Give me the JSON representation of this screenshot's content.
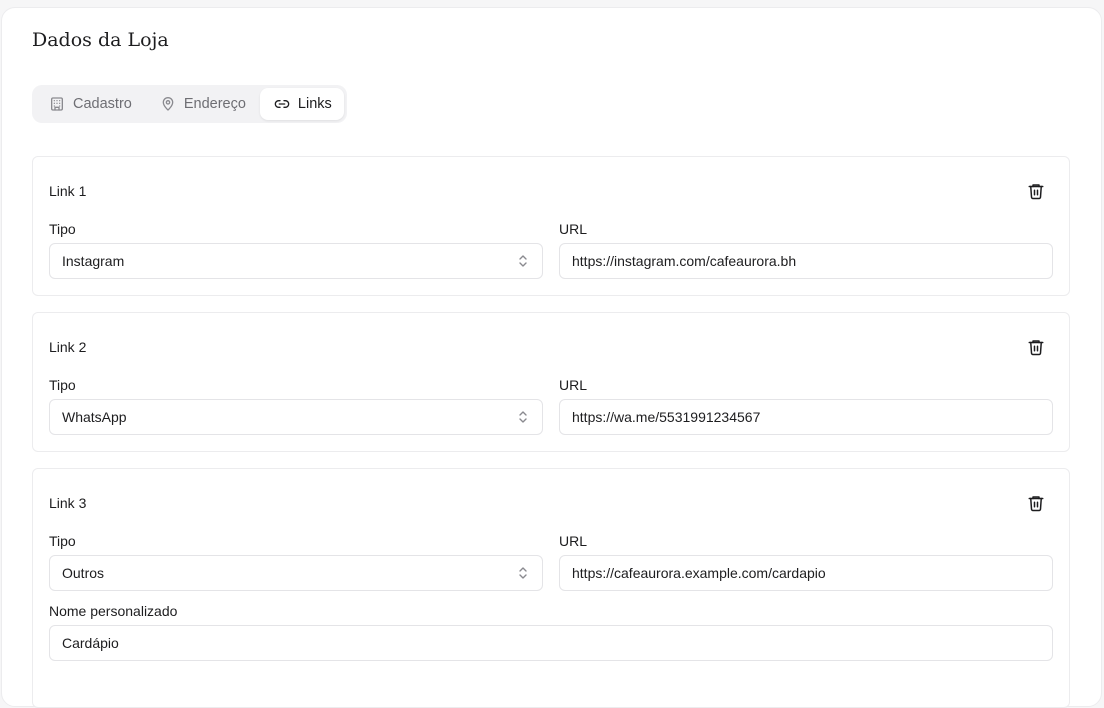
{
  "page": {
    "title": "Dados da Loja"
  },
  "tabs": [
    {
      "label": "Cadastro",
      "icon": "building-icon",
      "active": false
    },
    {
      "label": "Endereço",
      "icon": "map-pin-icon",
      "active": false
    },
    {
      "label": "Links",
      "icon": "link-icon",
      "active": true
    }
  ],
  "links": [
    {
      "title": "Link 1",
      "tipo_label": "Tipo",
      "tipo_value": "Instagram",
      "url_label": "URL",
      "url_value": "https://instagram.com/cafeaurora.bh"
    },
    {
      "title": "Link 2",
      "tipo_label": "Tipo",
      "tipo_value": "WhatsApp",
      "url_label": "URL",
      "url_value": "https://wa.me/5531991234567"
    },
    {
      "title": "Link 3",
      "tipo_label": "Tipo",
      "tipo_value": "Outros",
      "url_label": "URL",
      "url_value": "https://cafeaurora.example.com/cardapio",
      "custom_label": "Nome personalizado",
      "custom_value": "Cardápio"
    }
  ],
  "colors": {
    "background": "#f6f6f7",
    "card": "#ffffff",
    "border": "#e4e4e7",
    "text": "#1d1d1f",
    "muted": "#6e6e73",
    "tab_track": "#f2f2f4"
  }
}
